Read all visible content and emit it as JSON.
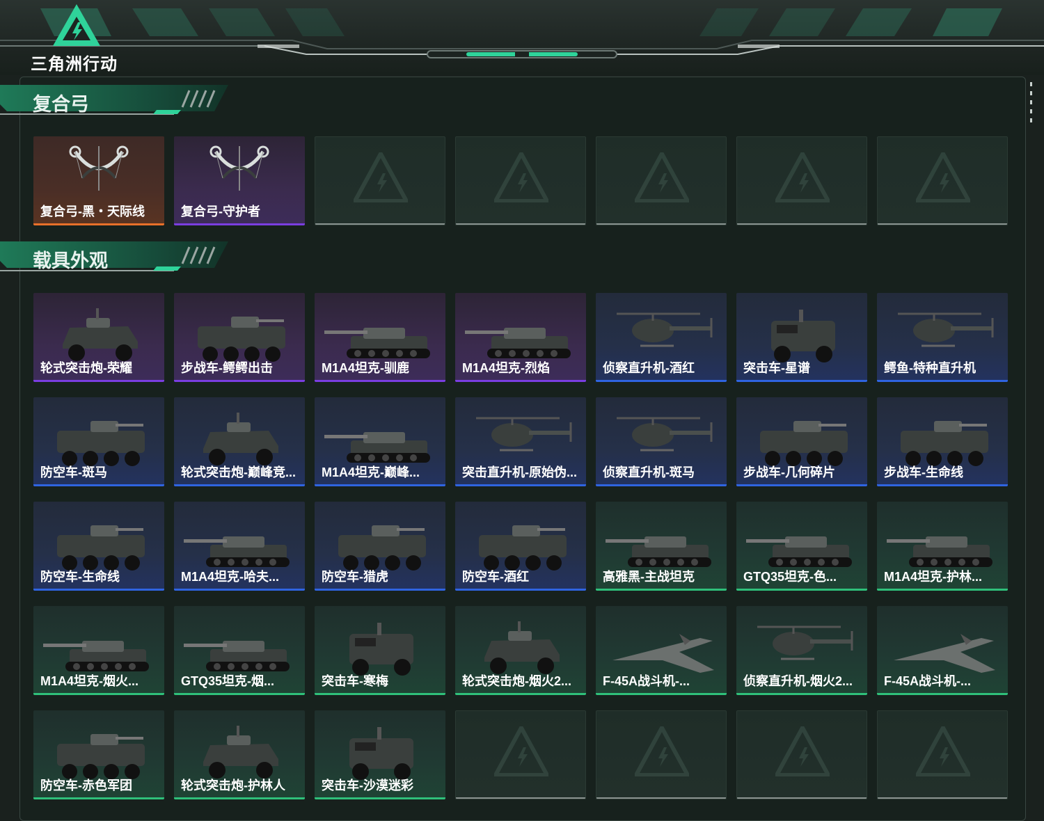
{
  "app": {
    "logo_text": "三角洲行动"
  },
  "colors": {
    "orange": "#e8702a",
    "purple": "#7a3ee0",
    "blue": "#2f64e0",
    "green": "#2fc07a",
    "empty": "#8b9491"
  },
  "sections": [
    {
      "title": "复合弓",
      "items": [
        {
          "label": "复合弓-黑・天际线",
          "rarity": "orange",
          "icon": "compound-bow-icon"
        },
        {
          "label": "复合弓-守护者",
          "rarity": "purple",
          "icon": "compound-bow-icon"
        },
        {
          "label": "",
          "rarity": "empty"
        },
        {
          "label": "",
          "rarity": "empty"
        },
        {
          "label": "",
          "rarity": "empty"
        },
        {
          "label": "",
          "rarity": "empty"
        },
        {
          "label": "",
          "rarity": "empty"
        }
      ]
    },
    {
      "title": "载具外观",
      "items": [
        {
          "label": "轮式突击炮-荣耀",
          "rarity": "purple",
          "icon": "armored-car-icon"
        },
        {
          "label": "步战车-鳄鳄出击",
          "rarity": "purple",
          "icon": "ifv-icon"
        },
        {
          "label": "M1A4坦克-驯鹿",
          "rarity": "purple",
          "icon": "tank-icon"
        },
        {
          "label": "M1A4坦克-烈焰",
          "rarity": "purple",
          "icon": "tank-icon"
        },
        {
          "label": "侦察直升机-酒红",
          "rarity": "blue",
          "icon": "helicopter-icon"
        },
        {
          "label": "突击车-星谱",
          "rarity": "blue",
          "icon": "assault-vehicle-icon"
        },
        {
          "label": "鳄鱼-特种直升机",
          "rarity": "blue",
          "icon": "helicopter-icon"
        },
        {
          "label": "防空车-斑马",
          "rarity": "blue",
          "icon": "ifv-icon"
        },
        {
          "label": "轮式突击炮-巅峰竞...",
          "rarity": "blue",
          "icon": "armored-car-icon"
        },
        {
          "label": "M1A4坦克-巅峰...",
          "rarity": "blue",
          "icon": "tank-icon"
        },
        {
          "label": "突击直升机-原始伪...",
          "rarity": "blue",
          "icon": "helicopter-icon"
        },
        {
          "label": "侦察直升机-斑马",
          "rarity": "blue",
          "icon": "helicopter-icon"
        },
        {
          "label": "步战车-几何碎片",
          "rarity": "blue",
          "icon": "ifv-icon"
        },
        {
          "label": "步战车-生命线",
          "rarity": "blue",
          "icon": "ifv-icon"
        },
        {
          "label": "防空车-生命线",
          "rarity": "blue",
          "icon": "ifv-icon"
        },
        {
          "label": "M1A4坦克-哈夫...",
          "rarity": "blue",
          "icon": "tank-icon"
        },
        {
          "label": "防空车-猎虎",
          "rarity": "blue",
          "icon": "ifv-icon"
        },
        {
          "label": "防空车-酒红",
          "rarity": "blue",
          "icon": "ifv-icon"
        },
        {
          "label": "高雅黑-主战坦克",
          "rarity": "green",
          "icon": "tank-icon"
        },
        {
          "label": "GTQ35坦克-色...",
          "rarity": "green",
          "icon": "tank-icon"
        },
        {
          "label": "M1A4坦克-护林...",
          "rarity": "green",
          "icon": "tank-icon"
        },
        {
          "label": "M1A4坦克-烟火...",
          "rarity": "green",
          "icon": "tank-icon"
        },
        {
          "label": "GTQ35坦克-烟...",
          "rarity": "green",
          "icon": "tank-icon"
        },
        {
          "label": "突击车-寒梅",
          "rarity": "green",
          "icon": "assault-vehicle-icon"
        },
        {
          "label": "轮式突击炮-烟火2...",
          "rarity": "green",
          "icon": "armored-car-icon"
        },
        {
          "label": "F-45A战斗机-...",
          "rarity": "green",
          "icon": "fighter-jet-icon"
        },
        {
          "label": "侦察直升机-烟火2...",
          "rarity": "green",
          "icon": "helicopter-icon"
        },
        {
          "label": "F-45A战斗机-...",
          "rarity": "green",
          "icon": "fighter-jet-icon"
        },
        {
          "label": "防空车-赤色军团",
          "rarity": "green",
          "icon": "ifv-icon"
        },
        {
          "label": "轮式突击炮-护林人",
          "rarity": "green",
          "icon": "armored-car-icon"
        },
        {
          "label": "突击车-沙漠迷彩",
          "rarity": "green",
          "icon": "assault-vehicle-icon"
        },
        {
          "label": "",
          "rarity": "empty"
        },
        {
          "label": "",
          "rarity": "empty"
        },
        {
          "label": "",
          "rarity": "empty"
        },
        {
          "label": "",
          "rarity": "empty"
        }
      ]
    }
  ]
}
